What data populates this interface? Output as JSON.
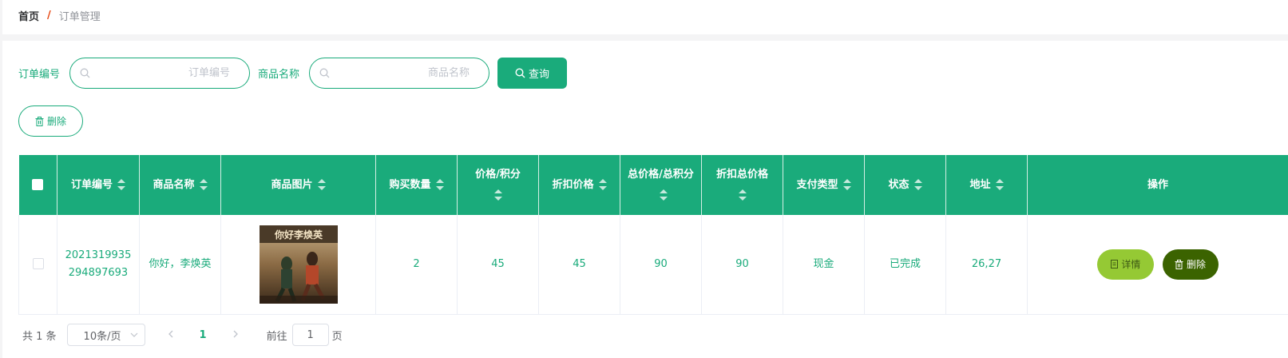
{
  "breadcrumb": {
    "home": "首页",
    "separator": "/",
    "current": "订单管理"
  },
  "search": {
    "order_no_label": "订单编号",
    "order_no_placeholder": "订单编号",
    "product_name_label": "商品名称",
    "product_name_placeholder": "商品名称",
    "query_label": "查询"
  },
  "toolbar": {
    "delete_label": "删除"
  },
  "table": {
    "headers": [
      "订单编号",
      "商品名称",
      "商品图片",
      "购买数量",
      "价格/积分",
      "折扣价格",
      "总价格/总积分",
      "折扣总价格",
      "支付类型",
      "状态",
      "地址",
      "操作"
    ],
    "rows": [
      {
        "order_no": "2021319935294897693",
        "product_name": "你好，李焕英",
        "image_title": "你好李焕英",
        "quantity": "2",
        "price": "45",
        "discount_price": "45",
        "total_price": "90",
        "discount_total": "90",
        "pay_type": "现金",
        "status": "已完成",
        "address": "26,27",
        "detail_label": "详情",
        "delete_label": "删除"
      }
    ]
  },
  "pagination": {
    "total_text": "共 1 条",
    "page_size": "10条/页",
    "current_page": "1",
    "goto_prefix": "前往",
    "goto_value": "1",
    "goto_suffix": "页"
  },
  "colors": {
    "primary": "#1aab7b",
    "detail_button": "#95c934",
    "delete_button": "#3b6300",
    "breadcrumb_separator": "#e6450f"
  }
}
